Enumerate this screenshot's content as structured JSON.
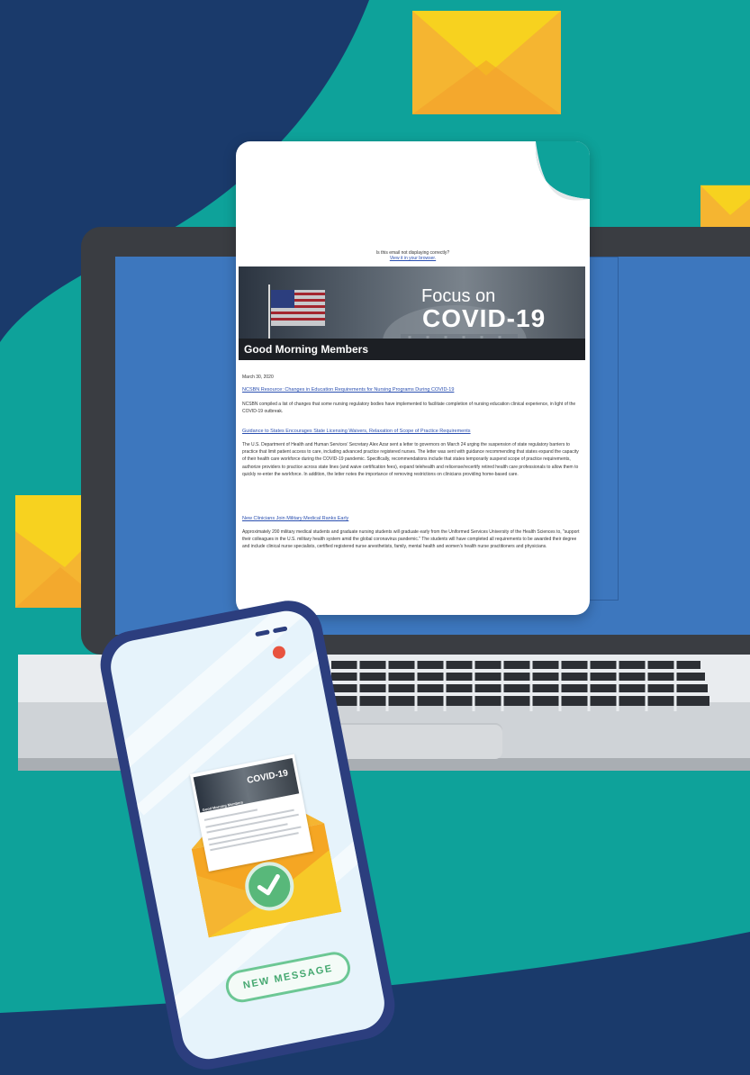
{
  "colors": {
    "navy": "#1a3a6b",
    "teal": "#0ea29a",
    "envelope_yellow": "#f7c928",
    "envelope_orange": "#f5a623",
    "screen_blue": "#3d77be",
    "phone_frame": "#2c3e7e",
    "accent_green": "#58b87a",
    "camera_red": "#e8533f"
  },
  "email": {
    "notice_line1": "Is this email not displaying correctly?",
    "notice_line2": "View it in your browser.",
    "banner_title_small": "Focus on",
    "banner_title_big": "COVID-19",
    "greeting": "Good Morning Members",
    "date": "March 30, 2020",
    "articles": [
      {
        "headline": "NCSBN Resource: Changes in Education Requirements for Nursing Programs During COVID-19",
        "body": "NCSBN compiled a list of changes that some nursing regulatory bodies have implemented to facilitate completion of nursing education clinical experience, in light of the COVID-19 outbreak."
      },
      {
        "headline": "Guidance to States Encourages State Licensing Waivers, Relaxation of Scope of Practice Requirements",
        "body": "The U.S. Department of Health and Human Services' Secretary Alex Azar sent a letter to governors on March 24 urging the suspension of state regulatory barriers to practice that limit patient access to care, including advanced practice registered nurses. The letter was sent with guidance recommending that states expand the capacity of their health care workforce during the COVID-19 pandemic. Specifically, recommendations include that states temporarily suspend scope of practice requirements, authorize providers to practice across state lines (and waive certification fees), expand telehealth and relicense/recertify retired health care professionals to allow them to quickly re-enter the workforce. In addition, the letter notes the importance of removing restrictions on clinicians providing home-based care."
      },
      {
        "headline": "New Clinicians Join Military Medical Ranks Early",
        "body": "Approximately 200 military medical students and graduate nursing students will graduate early from the Uniformed Services University of the Health Sciences to, \"support their colleagues in the U.S. military health system amid the global coronavirus pandemic.\" The students will have completed all requirements to be awarded their degree and include clinical nurse specialists, certified registered nurse anesthetists, family, mental health and women's health nurse practitioners and physicians."
      }
    ]
  },
  "phone": {
    "mini_banner_title": "COVID-19",
    "mini_greeting": "Good Morning Members",
    "badge_label": "NEW MESSAGE",
    "status_icon": "check-icon"
  },
  "icons": [
    "envelope-icon",
    "check-icon",
    "american-flag",
    "capitol-dome"
  ]
}
